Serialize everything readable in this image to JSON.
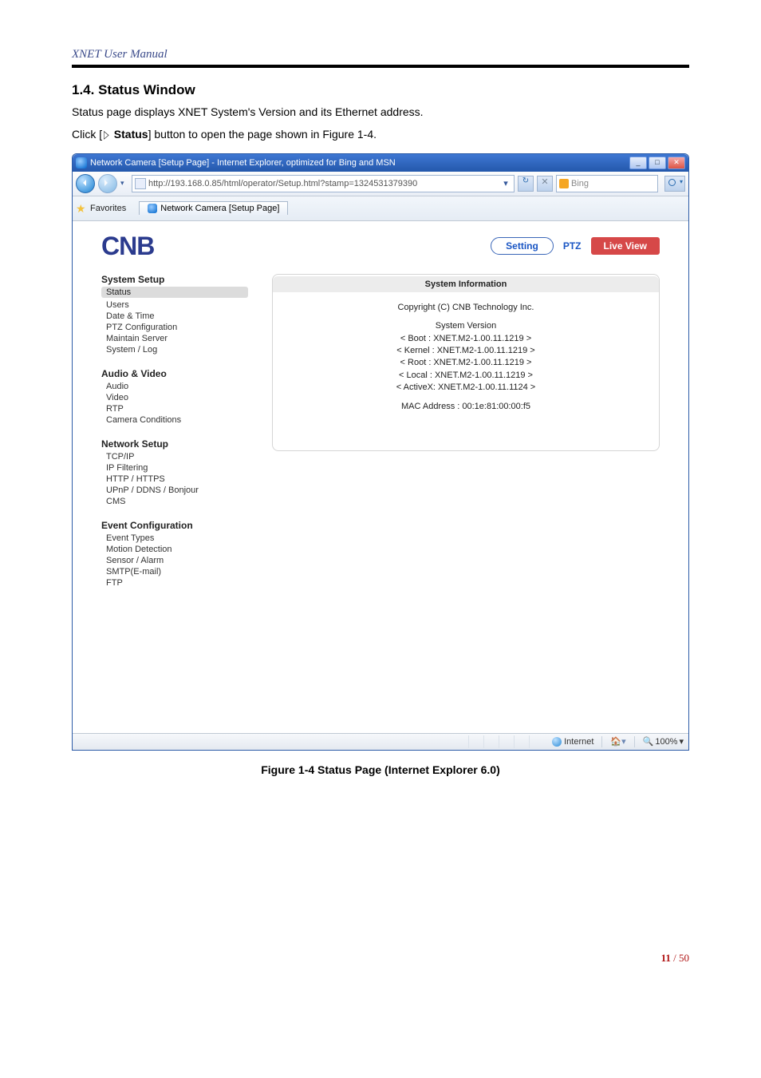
{
  "doc": {
    "header": "XNET User Manual",
    "section_number": "1.4. Status Window",
    "paragraph1": "Status page displays XNET System's Version and its Ethernet address.",
    "click_pre": "Click [",
    "click_arrow": "▷",
    "click_button": " Status",
    "click_post": "] button to open the page shown in Figure 1-4.",
    "caption": "Figure 1-4 Status Page (Internet Explorer 6.0)",
    "page_now": "11",
    "page_sep": " / ",
    "page_total": "50"
  },
  "browser": {
    "title": "Network Camera [Setup Page] - Internet Explorer, optimized for Bing and MSN",
    "url": "http://193.168.0.85/html/operator/Setup.html?stamp=1324531379390",
    "search_placeholder": "Bing",
    "favorites_label": "Favorites",
    "tab_label": "Network Camera [Setup Page]",
    "status_zone": "Internet",
    "zoom": "100%"
  },
  "page": {
    "logo": "CNB",
    "buttons": {
      "setting": "Setting",
      "ptz": "PTZ",
      "live": "Live View"
    },
    "side": {
      "g0": {
        "head": "System Setup",
        "status": "Status",
        "items": [
          "Users",
          "Date & Time",
          "PTZ Configuration",
          "Maintain Server",
          "System / Log"
        ]
      },
      "g1": {
        "head": "Audio & Video",
        "items": [
          "Audio",
          "Video",
          "RTP",
          "Camera Conditions"
        ]
      },
      "g2": {
        "head": "Network Setup",
        "items": [
          "TCP/IP",
          "IP Filtering",
          "HTTP / HTTPS",
          "UPnP / DDNS / Bonjour",
          "CMS"
        ]
      },
      "g3": {
        "head": "Event Configuration",
        "items": [
          "Event Types",
          "Motion Detection",
          "Sensor / Alarm",
          "SMTP(E-mail)",
          "FTP"
        ]
      }
    },
    "panel": {
      "header": "System Information",
      "copyright": "Copyright (C) CNB Technology Inc.",
      "version_label": "System Version",
      "lines": [
        "< Boot    : XNET.M2-1.00.11.1219 >",
        "< Kernel : XNET.M2-1.00.11.1219 >",
        "< Root    : XNET.M2-1.00.11.1219 >",
        "< Local   : XNET.M2-1.00.11.1219 >",
        "< ActiveX: XNET.M2-1.00.11.1124 >"
      ],
      "mac": "MAC Address : 00:1e:81:00:00:f5"
    }
  }
}
